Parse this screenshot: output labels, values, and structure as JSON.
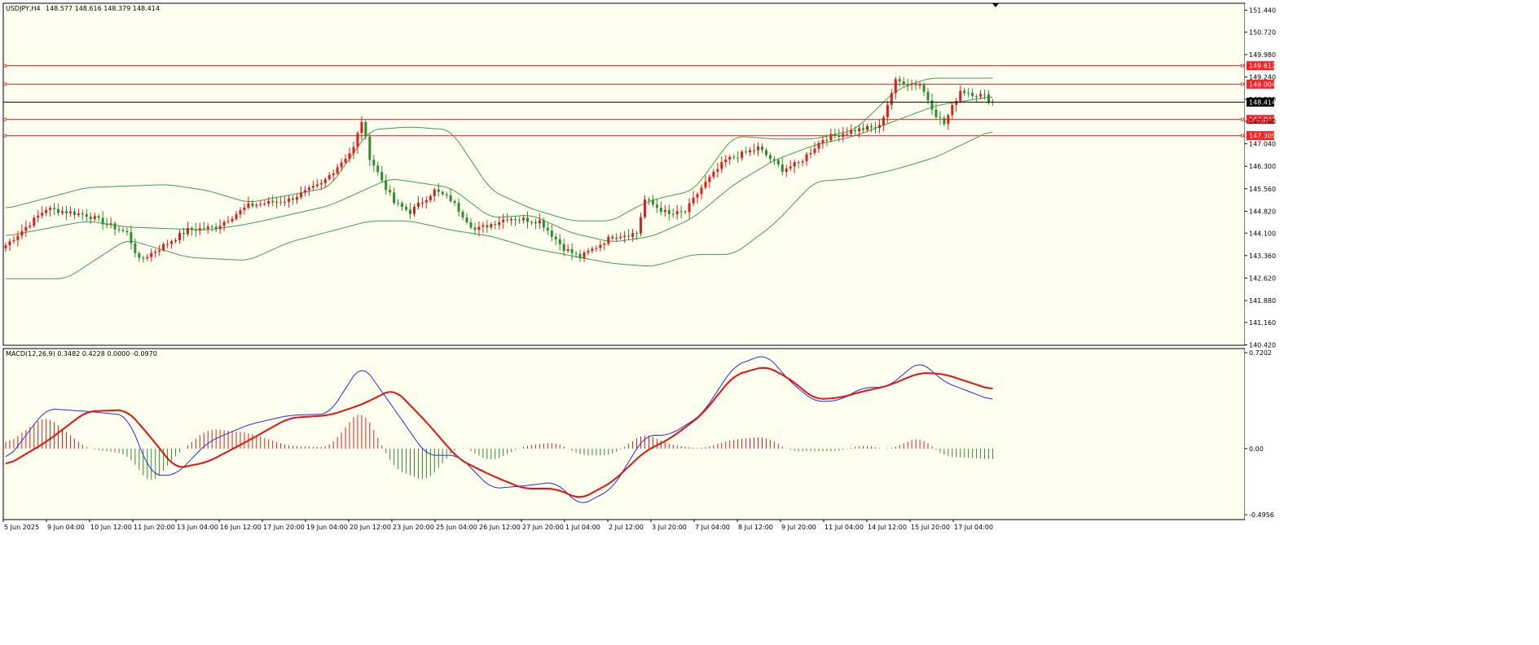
{
  "main_panel": {
    "symbol_label": "USDJPY,H4",
    "ohlc_label": "148.577 148.616 148.379 148.414",
    "y_ticks": [
      "151.440",
      "150.720",
      "149.980",
      "149.240",
      "148.500",
      "147.780",
      "147.040",
      "146.300",
      "145.560",
      "144.820",
      "144.100",
      "143.360",
      "142.620",
      "141.880",
      "141.160",
      "140.420"
    ],
    "current_price_label": "148.414",
    "level_labels": [
      "149.612",
      "149.004",
      "147.843",
      "147.309"
    ]
  },
  "macd_panel": {
    "indicator_label": "MACD(12,26,9) 0.3482 0.4228 0.0000 -0.0970",
    "y_ticks": [
      "0.7202",
      "0.00",
      "-0.4956"
    ]
  },
  "x_ticks": [
    "5 Jun 2025",
    "9 Jun 04:00",
    "10 Jun 12:00",
    "11 Jun 20:00",
    "13 Jun 04:00",
    "16 Jun 12:00",
    "17 Jun 20:00",
    "19 Jun 04:00",
    "20 Jun 12:00",
    "23 Jun 20:00",
    "25 Jun 04:00",
    "26 Jun 12:00",
    "27 Jun 20:00",
    "1 Jul 04:00",
    "2 Jul 12:00",
    "3 Jul 20:00",
    "7 Jul 04:00",
    "8 Jul 12:00",
    "9 Jul 20:00",
    "11 Jul 04:00",
    "14 Jul 12:00",
    "15 Jul 20:00",
    "17 Jul 04:00"
  ],
  "colors": {
    "background": "#fffff0",
    "bull_candle": "#e01c1c",
    "bear_candle": "#2e8b2e",
    "bollinger": "#3ca050",
    "level_line": "#ff2020",
    "price_line": "#000000",
    "macd_line": "#1a2fe0",
    "signal_line": "#e81010",
    "hist_positive": "#e01c1c",
    "hist_negative": "#2e8b2e"
  },
  "chart_data": [
    {
      "type": "candlestick",
      "title": "USDJPY,H4",
      "ylim": [
        140.42,
        151.44
      ],
      "last_close": 148.414,
      "horizontal_levels": [
        149.612,
        149.004,
        147.843,
        147.309
      ],
      "close_anchors": [
        [
          0,
          143.7
        ],
        [
          10,
          144.9
        ],
        [
          20,
          144.7
        ],
        [
          30,
          144.1
        ],
        [
          33,
          143.2
        ],
        [
          38,
          143.6
        ],
        [
          45,
          144.2
        ],
        [
          52,
          144.3
        ],
        [
          60,
          145.0
        ],
        [
          70,
          145.2
        ],
        [
          78,
          145.7
        ],
        [
          86,
          146.9
        ],
        [
          88,
          147.8
        ],
        [
          90,
          146.6
        ],
        [
          96,
          145.1
        ],
        [
          100,
          144.8
        ],
        [
          106,
          145.5
        ],
        [
          110,
          145.2
        ],
        [
          116,
          144.2
        ],
        [
          124,
          144.6
        ],
        [
          132,
          144.5
        ],
        [
          138,
          143.6
        ],
        [
          142,
          143.3
        ],
        [
          150,
          144.0
        ],
        [
          156,
          144.1
        ],
        [
          158,
          145.2
        ],
        [
          164,
          144.7
        ],
        [
          168,
          144.8
        ],
        [
          172,
          145.6
        ],
        [
          178,
          146.5
        ],
        [
          186,
          146.9
        ],
        [
          192,
          146.2
        ],
        [
          196,
          146.4
        ],
        [
          202,
          147.2
        ],
        [
          210,
          147.5
        ],
        [
          216,
          147.6
        ],
        [
          220,
          149.1
        ],
        [
          226,
          149.0
        ],
        [
          230,
          148.0
        ],
        [
          232,
          147.7
        ],
        [
          236,
          148.8
        ],
        [
          242,
          148.6
        ],
        [
          244,
          148.41
        ]
      ],
      "bollinger": {
        "upper": [
          [
            0,
            144.9
          ],
          [
            20,
            145.6
          ],
          [
            40,
            145.7
          ],
          [
            50,
            145.5
          ],
          [
            60,
            145.1
          ],
          [
            80,
            145.6
          ],
          [
            90,
            147.5
          ],
          [
            100,
            147.6
          ],
          [
            110,
            147.5
          ],
          [
            120,
            145.5
          ],
          [
            130,
            144.9
          ],
          [
            140,
            144.5
          ],
          [
            150,
            144.5
          ],
          [
            155,
            144.9
          ],
          [
            160,
            145.2
          ],
          [
            170,
            145.5
          ],
          [
            180,
            147.3
          ],
          [
            190,
            147.2
          ],
          [
            200,
            147.2
          ],
          [
            210,
            147.5
          ],
          [
            220,
            148.8
          ],
          [
            228,
            149.2
          ],
          [
            244,
            149.2
          ]
        ],
        "middle": [
          [
            0,
            144.0
          ],
          [
            20,
            144.5
          ],
          [
            30,
            144.3
          ],
          [
            50,
            144.2
          ],
          [
            60,
            144.4
          ],
          [
            80,
            145.0
          ],
          [
            95,
            145.9
          ],
          [
            110,
            145.6
          ],
          [
            120,
            144.6
          ],
          [
            130,
            144.7
          ],
          [
            140,
            144.1
          ],
          [
            150,
            143.8
          ],
          [
            160,
            144.0
          ],
          [
            170,
            144.6
          ],
          [
            180,
            145.7
          ],
          [
            190,
            146.5
          ],
          [
            200,
            147.0
          ],
          [
            210,
            147.3
          ],
          [
            220,
            147.8
          ],
          [
            230,
            148.3
          ],
          [
            244,
            148.6
          ]
        ],
        "lower": [
          [
            0,
            142.6
          ],
          [
            15,
            142.6
          ],
          [
            30,
            143.9
          ],
          [
            45,
            143.3
          ],
          [
            60,
            143.2
          ],
          [
            70,
            143.8
          ],
          [
            90,
            144.5
          ],
          [
            100,
            144.5
          ],
          [
            110,
            144.2
          ],
          [
            120,
            144.0
          ],
          [
            130,
            143.6
          ],
          [
            150,
            143.1
          ],
          [
            160,
            143.0
          ],
          [
            170,
            143.4
          ],
          [
            180,
            143.4
          ],
          [
            190,
            144.4
          ],
          [
            200,
            145.8
          ],
          [
            210,
            145.9
          ],
          [
            220,
            146.2
          ],
          [
            230,
            146.6
          ],
          [
            244,
            147.5
          ]
        ]
      }
    },
    {
      "type": "macd",
      "title": "MACD(12,26,9)",
      "params": [
        12,
        26,
        9
      ],
      "last_values": {
        "macd": 0.3482,
        "signal": 0.4228,
        "histogram": -0.097
      },
      "ylim": [
        -0.4956,
        0.7202
      ],
      "macd_line": [
        [
          0,
          -0.1
        ],
        [
          10,
          0.3
        ],
        [
          20,
          0.28
        ],
        [
          30,
          0.25
        ],
        [
          36,
          -0.2
        ],
        [
          42,
          -0.2
        ],
        [
          50,
          0.05
        ],
        [
          60,
          0.18
        ],
        [
          70,
          0.25
        ],
        [
          80,
          0.26
        ],
        [
          88,
          0.64
        ],
        [
          96,
          0.3
        ],
        [
          104,
          -0.05
        ],
        [
          112,
          -0.05
        ],
        [
          120,
          -0.3
        ],
        [
          128,
          -0.28
        ],
        [
          136,
          -0.25
        ],
        [
          142,
          -0.43
        ],
        [
          150,
          -0.3
        ],
        [
          158,
          0.1
        ],
        [
          164,
          0.1
        ],
        [
          172,
          0.25
        ],
        [
          180,
          0.62
        ],
        [
          188,
          0.71
        ],
        [
          194,
          0.5
        ],
        [
          200,
          0.35
        ],
        [
          206,
          0.36
        ],
        [
          212,
          0.46
        ],
        [
          218,
          0.46
        ],
        [
          226,
          0.66
        ],
        [
          232,
          0.5
        ],
        [
          244,
          0.36
        ]
      ],
      "signal_line": [
        [
          0,
          -0.13
        ],
        [
          10,
          0.05
        ],
        [
          20,
          0.28
        ],
        [
          30,
          0.29
        ],
        [
          36,
          0.08
        ],
        [
          42,
          -0.15
        ],
        [
          50,
          -0.1
        ],
        [
          60,
          0.06
        ],
        [
          70,
          0.23
        ],
        [
          80,
          0.25
        ],
        [
          88,
          0.33
        ],
        [
          96,
          0.45
        ],
        [
          104,
          0.2
        ],
        [
          112,
          -0.08
        ],
        [
          120,
          -0.2
        ],
        [
          128,
          -0.3
        ],
        [
          136,
          -0.3
        ],
        [
          142,
          -0.38
        ],
        [
          150,
          -0.25
        ],
        [
          158,
          -0.02
        ],
        [
          164,
          0.07
        ],
        [
          172,
          0.25
        ],
        [
          180,
          0.55
        ],
        [
          188,
          0.62
        ],
        [
          194,
          0.52
        ],
        [
          200,
          0.37
        ],
        [
          206,
          0.38
        ],
        [
          212,
          0.43
        ],
        [
          218,
          0.47
        ],
        [
          226,
          0.57
        ],
        [
          232,
          0.56
        ],
        [
          244,
          0.44
        ]
      ]
    }
  ]
}
